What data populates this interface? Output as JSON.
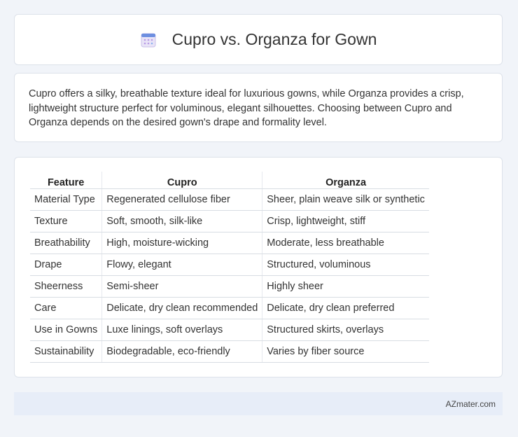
{
  "header": {
    "title": "Cupro vs. Organza for Gown",
    "icon": "calendar-icon"
  },
  "description": "Cupro offers a silky, breathable texture ideal for luxurious gowns, while Organza provides a crisp, lightweight structure perfect for voluminous, elegant silhouettes. Choosing between Cupro and Organza depends on the desired gown's drape and formality level.",
  "table": {
    "headers": [
      "Feature",
      "Cupro",
      "Organza"
    ],
    "rows": [
      [
        "Material Type",
        "Regenerated cellulose fiber",
        "Sheer, plain weave silk or synthetic"
      ],
      [
        "Texture",
        "Soft, smooth, silk-like",
        "Crisp, lightweight, stiff"
      ],
      [
        "Breathability",
        "High, moisture-wicking",
        "Moderate, less breathable"
      ],
      [
        "Drape",
        "Flowy, elegant",
        "Structured, voluminous"
      ],
      [
        "Sheerness",
        "Semi-sheer",
        "Highly sheer"
      ],
      [
        "Care",
        "Delicate, dry clean recommended",
        "Delicate, dry clean preferred"
      ],
      [
        "Use in Gowns",
        "Luxe linings, soft overlays",
        "Structured skirts, overlays"
      ],
      [
        "Sustainability",
        "Biodegradable, eco-friendly",
        "Varies by fiber source"
      ]
    ]
  },
  "footer": {
    "brand": "AZmater.com"
  }
}
